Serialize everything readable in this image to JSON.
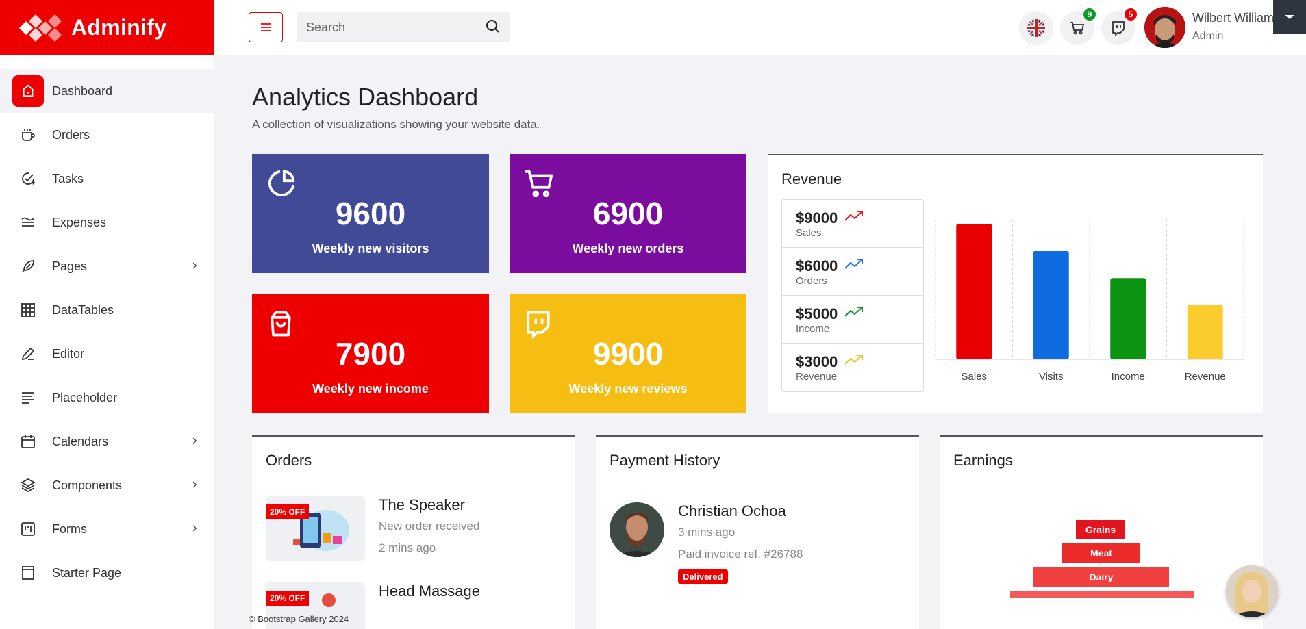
{
  "brand": {
    "name": "Adminify"
  },
  "sidebar": {
    "items": [
      {
        "label": "Dashboard",
        "icon": "home-icon",
        "active": true,
        "submenu": false
      },
      {
        "label": "Orders",
        "icon": "coffee-cup-icon",
        "submenu": false
      },
      {
        "label": "Tasks",
        "icon": "check-circle-icon",
        "submenu": false
      },
      {
        "label": "Expenses",
        "icon": "wave-lines-icon",
        "submenu": false
      },
      {
        "label": "Pages",
        "icon": "feather-icon",
        "submenu": true
      },
      {
        "label": "DataTables",
        "icon": "grid-icon",
        "submenu": false
      },
      {
        "label": "Editor",
        "icon": "pencil-icon",
        "submenu": false
      },
      {
        "label": "Placeholder",
        "icon": "text-lines-icon",
        "submenu": false
      },
      {
        "label": "Calendars",
        "icon": "calendar-icon",
        "submenu": true
      },
      {
        "label": "Components",
        "icon": "layers-icon",
        "submenu": true
      },
      {
        "label": "Forms",
        "icon": "kanban-icon",
        "submenu": true
      },
      {
        "label": "Starter Page",
        "icon": "window-icon",
        "submenu": false
      }
    ]
  },
  "topbar": {
    "search_placeholder": "Search",
    "cart_count": "9",
    "messages_count": "5",
    "user_name": "Wilbert William",
    "user_role": "Admin",
    "colors": {
      "cart_badge": "#0a9b2a",
      "messages_badge": "#ee0000"
    }
  },
  "main": {
    "title": "Analytics Dashboard",
    "subtitle": "A collection of visualizations showing your website data.",
    "stats": [
      {
        "value": "9600",
        "label": "Weekly new visitors",
        "icon": "pie-chart-icon",
        "color": "#414a96"
      },
      {
        "value": "6900",
        "label": "Weekly new orders",
        "icon": "cart-icon",
        "color": "#7a0d9e"
      },
      {
        "value": "7900",
        "label": "Weekly new income",
        "icon": "shopping-bag-icon",
        "color": "#ee0000"
      },
      {
        "value": "9900",
        "label": "Weekly new reviews",
        "icon": "twitch-icon",
        "color": "#f6bd12"
      }
    ],
    "revenue": {
      "title": "Revenue",
      "items": [
        {
          "value": "$9000",
          "label": "Sales",
          "trend_color": "#e81c1c"
        },
        {
          "value": "$6000",
          "label": "Orders",
          "trend_color": "#1e73e8"
        },
        {
          "value": "$5000",
          "label": "Income",
          "trend_color": "#0a9b2a"
        },
        {
          "value": "$3000",
          "label": "Revenue",
          "trend_color": "#f6bd12"
        }
      ]
    },
    "orders": {
      "title": "Orders",
      "items": [
        {
          "name": "The Speaker",
          "desc": "New order received",
          "time": "2 mins ago",
          "tag": "20% OFF"
        },
        {
          "name": "Head Massage",
          "desc": "",
          "time": "",
          "tag": "20% OFF"
        }
      ]
    },
    "payments": {
      "title": "Payment History",
      "name": "Christian Ochoa",
      "time": "3 mins ago",
      "ref": "Paid invoice ref. #26788",
      "status": "Delivered"
    },
    "earnings": {
      "title": "Earnings",
      "levels": [
        "Grains",
        "Meat",
        "Dairy"
      ]
    }
  },
  "chart_data": {
    "type": "bar",
    "categories": [
      "Sales",
      "Visits",
      "Income",
      "Revenue"
    ],
    "values": [
      100,
      80,
      60,
      40
    ],
    "colors": [
      "#e80000",
      "#0e6be0",
      "#0a9412",
      "#fccc2c"
    ],
    "grid": true,
    "legend": false
  },
  "footer": {
    "text": "© Bootstrap Gallery 2024"
  }
}
